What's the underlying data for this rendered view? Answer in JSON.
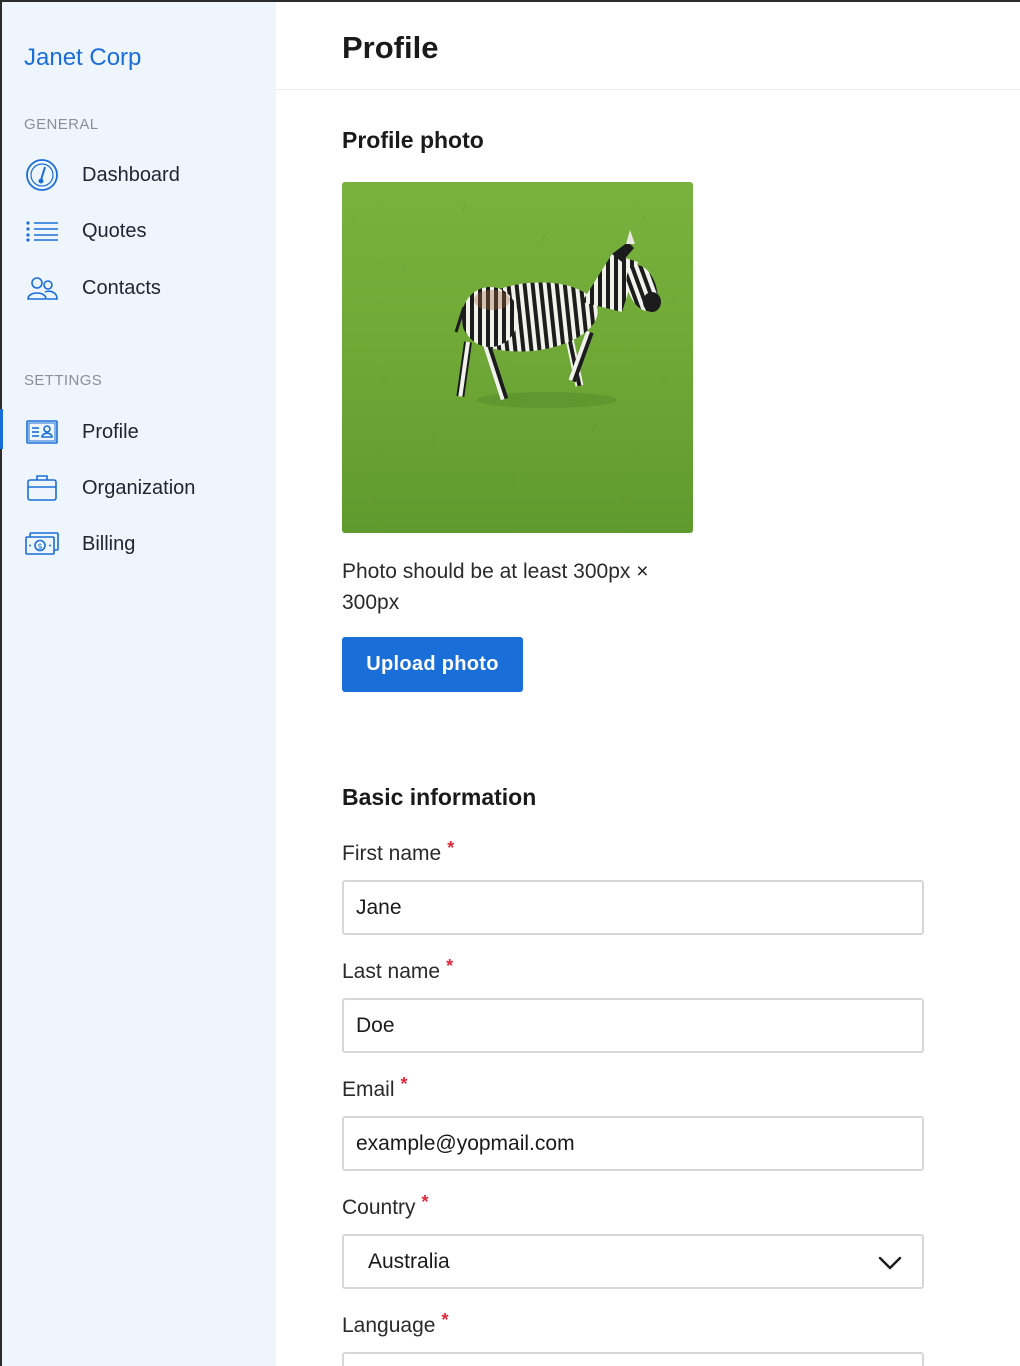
{
  "sidebar": {
    "brand": "Janet Corp",
    "general_label": "GENERAL",
    "settings_label": "SETTINGS",
    "general_items": [
      {
        "label": "Dashboard",
        "icon": "gauge-icon"
      },
      {
        "label": "Quotes",
        "icon": "list-icon"
      },
      {
        "label": "Contacts",
        "icon": "people-icon"
      }
    ],
    "settings_items": [
      {
        "label": "Profile",
        "icon": "id-card-icon",
        "active": true
      },
      {
        "label": "Organization",
        "icon": "briefcase-icon"
      },
      {
        "label": "Billing",
        "icon": "banknote-icon"
      }
    ]
  },
  "header": {
    "title": "Profile"
  },
  "photo_section": {
    "title": "Profile photo",
    "hint": "Photo should be at least 300px × 300px",
    "upload_label": "Upload photo"
  },
  "basic_info": {
    "title": "Basic information",
    "required_mark": "*",
    "first_name": {
      "label": "First name",
      "value": "Jane"
    },
    "last_name": {
      "label": "Last name",
      "value": "Doe"
    },
    "email": {
      "label": "Email",
      "value": "example@yopmail.com"
    },
    "country": {
      "label": "Country",
      "value": "Australia"
    },
    "language": {
      "label": "Language"
    }
  },
  "colors": {
    "accent": "#1a6ed8",
    "sidebar_bg": "#eff5fd",
    "required": "#e0283d",
    "border": "#d7d7d7"
  }
}
